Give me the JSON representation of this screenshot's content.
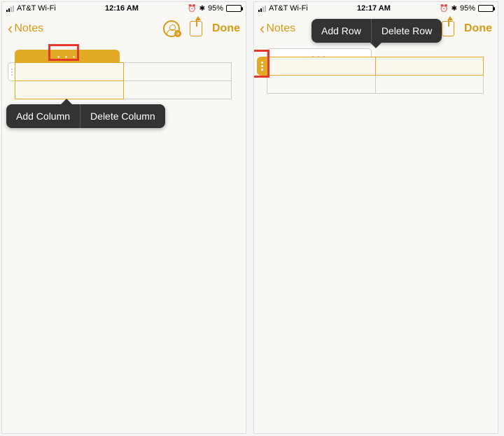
{
  "left": {
    "status": {
      "carrier": "AT&T Wi-Fi",
      "time": "12:16 AM",
      "battery_pct": "95%"
    },
    "nav": {
      "back": "Notes",
      "done": "Done"
    },
    "menu": {
      "add": "Add Column",
      "del": "Delete Column"
    }
  },
  "right": {
    "status": {
      "carrier": "AT&T Wi-Fi",
      "time": "12:17 AM",
      "battery_pct": "95%"
    },
    "nav": {
      "back": "Notes",
      "done": "Done"
    },
    "menu": {
      "add": "Add Row",
      "del": "Delete Row"
    }
  }
}
